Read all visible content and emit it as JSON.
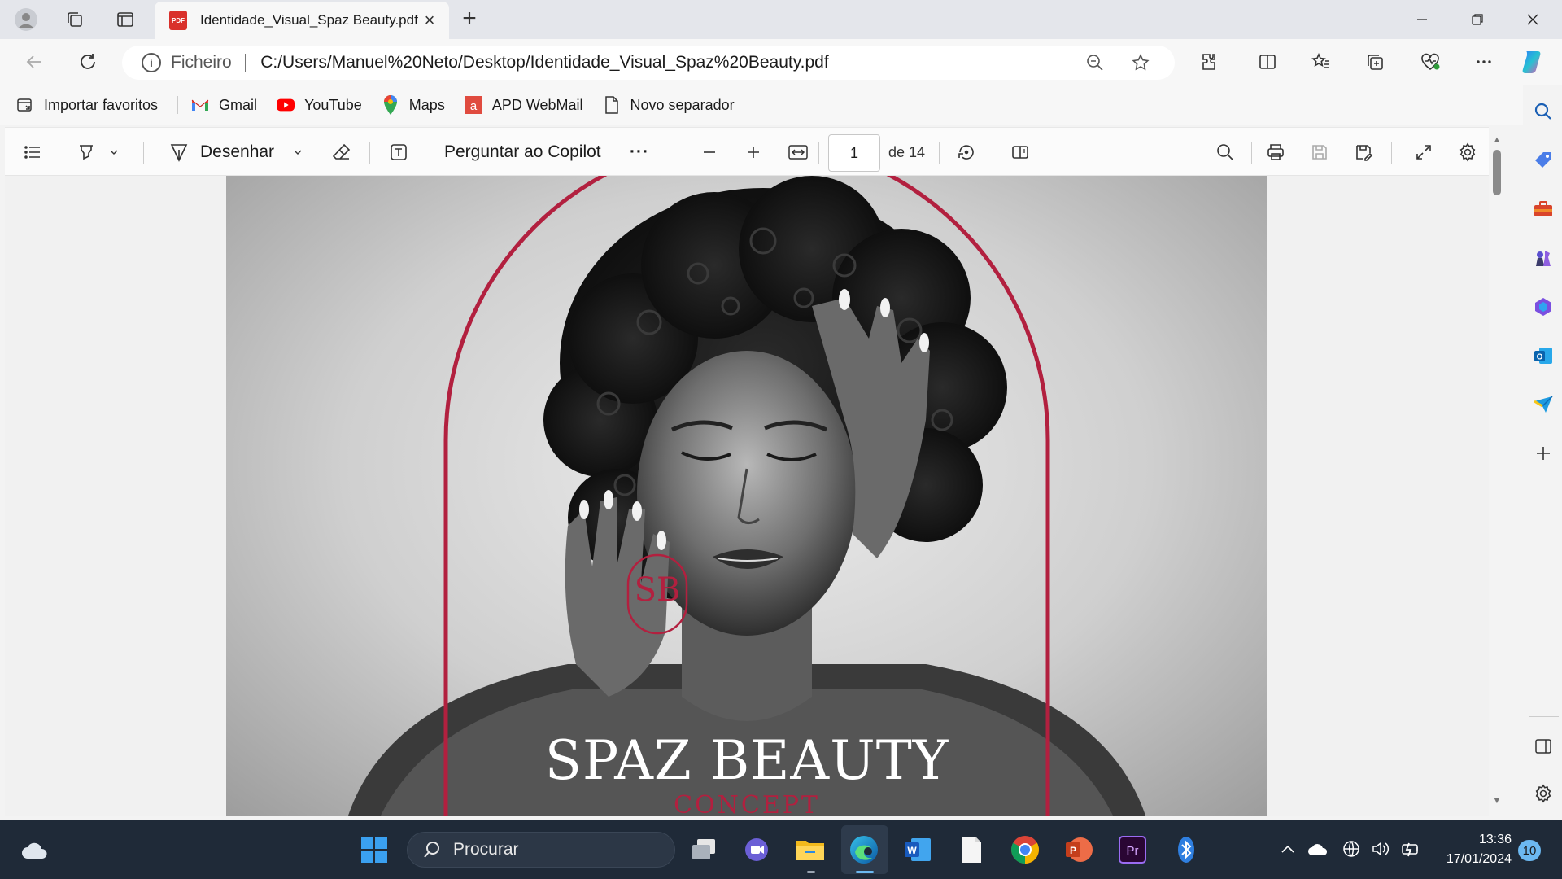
{
  "tab": {
    "title": "Identidade_Visual_Spaz Beauty.pdf",
    "pdf_badge": "PDF",
    "close_glyph": "×",
    "new_glyph": "+"
  },
  "address": {
    "info_glyph": "i",
    "label": "Ficheiro",
    "url": "C:/Users/Manuel%20Neto/Desktop/Identidade_Visual_Spaz%20Beauty.pdf"
  },
  "favorites": [
    {
      "label": "Importar favoritos",
      "icon": "import-icon"
    },
    {
      "label": "Gmail",
      "icon": "gmail-icon"
    },
    {
      "label": "YouTube",
      "icon": "youtube-icon"
    },
    {
      "label": "Maps",
      "icon": "maps-icon"
    },
    {
      "label": "APD WebMail",
      "icon": "webmail-icon"
    },
    {
      "label": "Novo separador",
      "icon": "page-icon"
    }
  ],
  "pdf_toolbar": {
    "draw_label": "Desenhar",
    "copilot_label": "Perguntar ao Copilot",
    "more_glyph": "···",
    "page_current": "1",
    "page_total_label": "de 14"
  },
  "document": {
    "monogram": "SB",
    "brand_name": "SPAZ BEAUTY",
    "brand_sub": "CONCEPT",
    "accent": "#b2203f"
  },
  "taskbar": {
    "search_placeholder": "Procurar",
    "time": "13:36",
    "date": "17/01/2024",
    "notifications": "10",
    "word_glyph": "W",
    "premiere_glyph": "Pr"
  },
  "colors": {
    "accent_edge": "#0c59a4",
    "taskbar_bg": "#1f2a38",
    "brand_red": "#b2203f"
  }
}
